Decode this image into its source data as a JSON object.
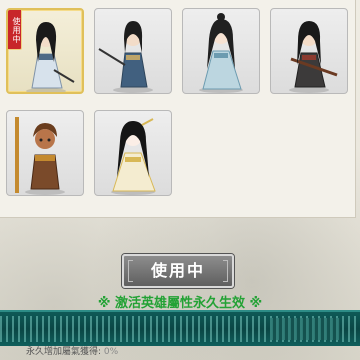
{
  "heroes": [
    {
      "id": "hero-1",
      "selected": true,
      "tag": "使用中",
      "hair": "#1a1a1a",
      "robe": "#d7e2ec",
      "accent": "#4f6b86"
    },
    {
      "id": "hero-2",
      "selected": false,
      "tag": "",
      "hair": "#1d1d1d",
      "robe": "#41607f",
      "accent": "#2f465c"
    },
    {
      "id": "hero-3",
      "selected": false,
      "tag": "",
      "hair": "#202020",
      "robe": "#bcd6e0",
      "accent": "#6c9bb0"
    },
    {
      "id": "hero-4",
      "selected": false,
      "tag": "",
      "hair": "#191919",
      "robe": "#3c3a3a",
      "accent": "#8b3a2f"
    },
    {
      "id": "hero-5",
      "selected": false,
      "tag": "",
      "hair": "#6a3d1e",
      "robe": "#7a4a2a",
      "accent": "#c48a2f"
    },
    {
      "id": "hero-6",
      "selected": false,
      "tag": "",
      "hair": "#151515",
      "robe": "#f4ecd0",
      "accent": "#d8b856"
    }
  ],
  "use_button": {
    "label": "使用中"
  },
  "effect_text": "※ 激活英雄屬性永久生效 ※",
  "footer": {
    "text": "永久增加屬氣獲得:",
    "value": "0%"
  },
  "colors": {
    "selected_border": "#e0c05a",
    "effect_green": "#23a235",
    "band": "#0a4644"
  }
}
